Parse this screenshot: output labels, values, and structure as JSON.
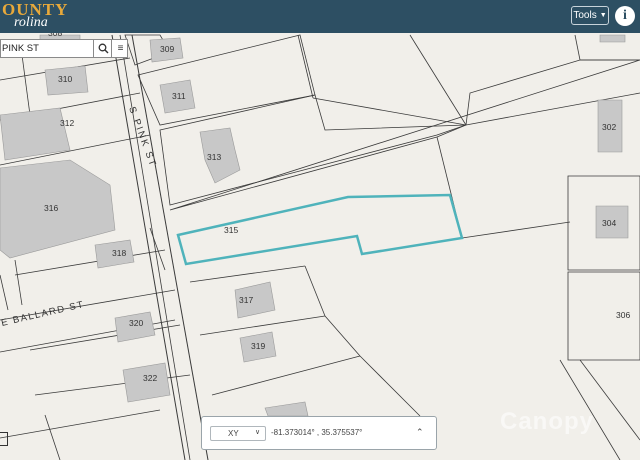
{
  "header": {
    "logo_top": "OUNTY",
    "logo_bottom": "rolina",
    "tools_label": "Tools",
    "info_glyph": "i"
  },
  "search": {
    "value": "PINK ST"
  },
  "map": {
    "streets": [
      "S PINK ST",
      "E BALLARD ST"
    ],
    "parcels": [
      "308",
      "309",
      "310",
      "311",
      "312",
      "313",
      "315",
      "316",
      "317",
      "318",
      "319",
      "320",
      "322",
      "302",
      "304",
      "306"
    ],
    "selected_parcel": "315",
    "selection_color": "#4fb3bb"
  },
  "coords": {
    "projection": "XY",
    "value": "-81.373014° , 35.375537°"
  },
  "watermark": "Canopy",
  "colors": {
    "header_bg": "#2d4f63",
    "logo_accent": "#e8a93a",
    "map_bg": "#f1efea",
    "building": "#c8c8c8"
  }
}
